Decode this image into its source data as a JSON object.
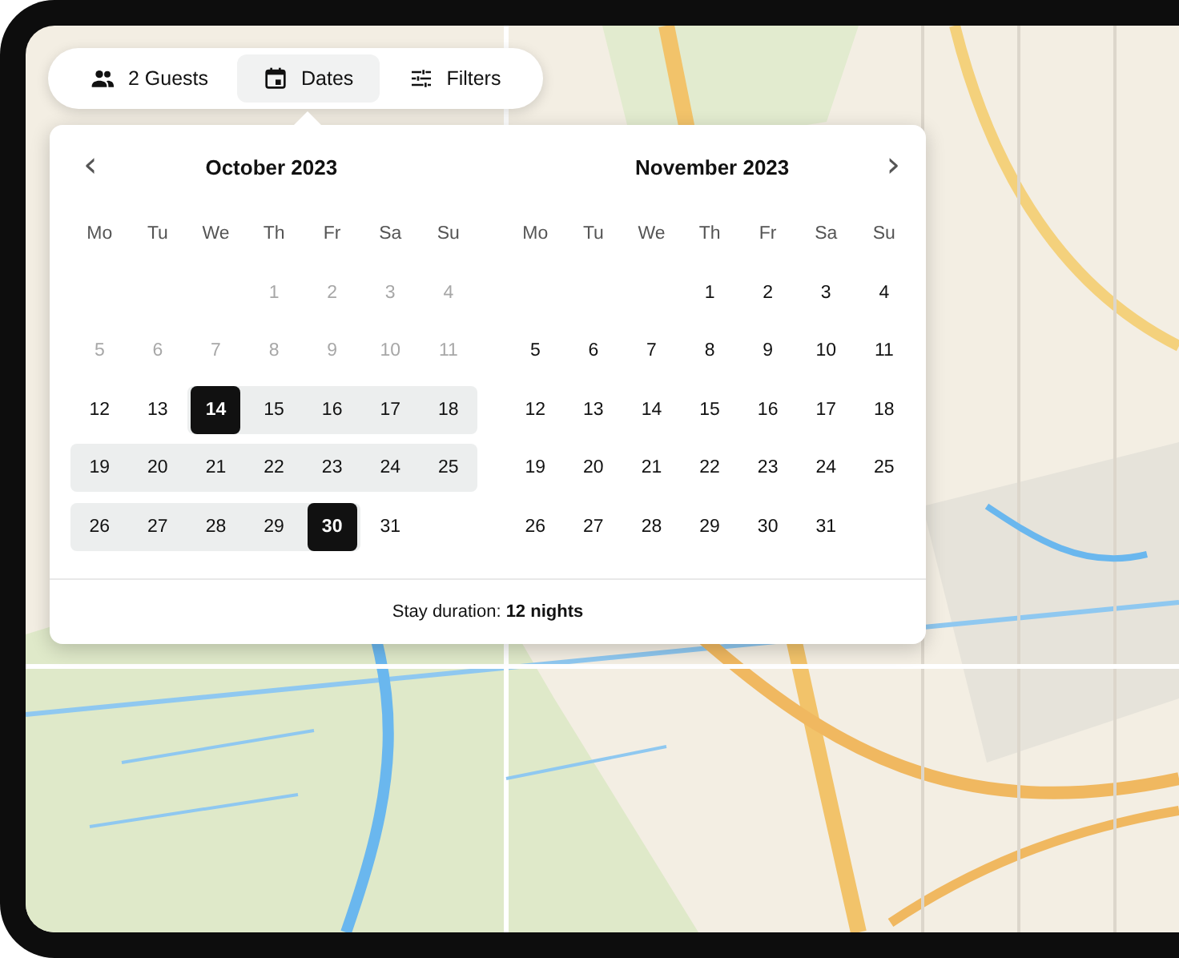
{
  "toolbar": {
    "items": [
      {
        "kind": "guests",
        "label": "2 Guests",
        "selected": false
      },
      {
        "kind": "dates",
        "label": "Dates",
        "selected": true
      },
      {
        "kind": "filters",
        "label": "Filters",
        "selected": false
      }
    ]
  },
  "calendar": {
    "prev_button": "‹",
    "next_button": "›",
    "months": [
      {
        "title": "October 2023",
        "weekdays": [
          "Mo",
          "Tu",
          "We",
          "Th",
          "Fr",
          "Sa",
          "Su"
        ],
        "weeks": [
          [
            {
              "kind": "blank"
            },
            {
              "kind": "blank"
            },
            {
              "kind": "blank"
            },
            {
              "kind": "date",
              "day": "1",
              "disabled": true,
              "selected": false,
              "in_range": false
            },
            {
              "kind": "date",
              "day": "2",
              "disabled": true,
              "selected": false,
              "in_range": false
            },
            {
              "kind": "date",
              "day": "3",
              "disabled": true,
              "selected": false,
              "in_range": false
            },
            {
              "kind": "date",
              "day": "4",
              "disabled": true,
              "selected": false,
              "in_range": false
            }
          ],
          [
            {
              "kind": "date",
              "day": "5",
              "disabled": true,
              "selected": false,
              "in_range": false
            },
            {
              "kind": "date",
              "day": "6",
              "disabled": true,
              "selected": false,
              "in_range": false
            },
            {
              "kind": "date",
              "day": "7",
              "disabled": true,
              "selected": false,
              "in_range": false
            },
            {
              "kind": "date",
              "day": "8",
              "disabled": true,
              "selected": false,
              "in_range": false
            },
            {
              "kind": "date",
              "day": "9",
              "disabled": true,
              "selected": false,
              "in_range": false
            },
            {
              "kind": "date",
              "day": "10",
              "disabled": true,
              "selected": false,
              "in_range": false
            },
            {
              "kind": "date",
              "day": "11",
              "disabled": true,
              "selected": false,
              "in_range": false
            }
          ],
          [
            {
              "kind": "date",
              "day": "12",
              "disabled": false,
              "selected": false,
              "in_range": false
            },
            {
              "kind": "date",
              "day": "13",
              "disabled": false,
              "selected": false,
              "in_range": false
            },
            {
              "kind": "date",
              "day": "14",
              "disabled": false,
              "selected": true,
              "in_range": true
            },
            {
              "kind": "date",
              "day": "15",
              "disabled": false,
              "selected": false,
              "in_range": true
            },
            {
              "kind": "date",
              "day": "16",
              "disabled": false,
              "selected": false,
              "in_range": true
            },
            {
              "kind": "date",
              "day": "17",
              "disabled": false,
              "selected": false,
              "in_range": true
            },
            {
              "kind": "date",
              "day": "18",
              "disabled": false,
              "selected": false,
              "in_range": true
            }
          ],
          [
            {
              "kind": "date",
              "day": "19",
              "disabled": false,
              "selected": false,
              "in_range": true
            },
            {
              "kind": "date",
              "day": "20",
              "disabled": false,
              "selected": false,
              "in_range": true
            },
            {
              "kind": "date",
              "day": "21",
              "disabled": false,
              "selected": false,
              "in_range": true
            },
            {
              "kind": "date",
              "day": "22",
              "disabled": false,
              "selected": false,
              "in_range": true
            },
            {
              "kind": "date",
              "day": "23",
              "disabled": false,
              "selected": false,
              "in_range": true
            },
            {
              "kind": "date",
              "day": "24",
              "disabled": false,
              "selected": false,
              "in_range": true
            },
            {
              "kind": "date",
              "day": "25",
              "disabled": false,
              "selected": false,
              "in_range": true
            }
          ],
          [
            {
              "kind": "date",
              "day": "26",
              "disabled": false,
              "selected": false,
              "in_range": true
            },
            {
              "kind": "date",
              "day": "27",
              "disabled": false,
              "selected": false,
              "in_range": true
            },
            {
              "kind": "date",
              "day": "28",
              "disabled": false,
              "selected": false,
              "in_range": true
            },
            {
              "kind": "date",
              "day": "29",
              "disabled": false,
              "selected": false,
              "in_range": true
            },
            {
              "kind": "date",
              "day": "30",
              "disabled": false,
              "selected": true,
              "in_range": true
            },
            {
              "kind": "date",
              "day": "31",
              "disabled": false,
              "selected": false,
              "in_range": false
            },
            {
              "kind": "blank"
            }
          ]
        ]
      },
      {
        "title": "November 2023",
        "weekdays": [
          "Mo",
          "Tu",
          "We",
          "Th",
          "Fr",
          "Sa",
          "Su"
        ],
        "weeks": [
          [
            {
              "kind": "blank"
            },
            {
              "kind": "blank"
            },
            {
              "kind": "blank"
            },
            {
              "kind": "date",
              "day": "1",
              "disabled": false,
              "selected": false,
              "in_range": false
            },
            {
              "kind": "date",
              "day": "2",
              "disabled": false,
              "selected": false,
              "in_range": false
            },
            {
              "kind": "date",
              "day": "3",
              "disabled": false,
              "selected": false,
              "in_range": false
            },
            {
              "kind": "date",
              "day": "4",
              "disabled": false,
              "selected": false,
              "in_range": false
            }
          ],
          [
            {
              "kind": "date",
              "day": "5",
              "disabled": false,
              "selected": false,
              "in_range": false
            },
            {
              "kind": "date",
              "day": "6",
              "disabled": false,
              "selected": false,
              "in_range": false
            },
            {
              "kind": "date",
              "day": "7",
              "disabled": false,
              "selected": false,
              "in_range": false
            },
            {
              "kind": "date",
              "day": "8",
              "disabled": false,
              "selected": false,
              "in_range": false
            },
            {
              "kind": "date",
              "day": "9",
              "disabled": false,
              "selected": false,
              "in_range": false
            },
            {
              "kind": "date",
              "day": "10",
              "disabled": false,
              "selected": false,
              "in_range": false
            },
            {
              "kind": "date",
              "day": "11",
              "disabled": false,
              "selected": false,
              "in_range": false
            }
          ],
          [
            {
              "kind": "date",
              "day": "12",
              "disabled": false,
              "selected": false,
              "in_range": false
            },
            {
              "kind": "date",
              "day": "13",
              "disabled": false,
              "selected": false,
              "in_range": false
            },
            {
              "kind": "date",
              "day": "14",
              "disabled": false,
              "selected": false,
              "in_range": false
            },
            {
              "kind": "date",
              "day": "15",
              "disabled": false,
              "selected": false,
              "in_range": false
            },
            {
              "kind": "date",
              "day": "16",
              "disabled": false,
              "selected": false,
              "in_range": false
            },
            {
              "kind": "date",
              "day": "17",
              "disabled": false,
              "selected": false,
              "in_range": false
            },
            {
              "kind": "date",
              "day": "18",
              "disabled": false,
              "selected": false,
              "in_range": false
            }
          ],
          [
            {
              "kind": "date",
              "day": "19",
              "disabled": false,
              "selected": false,
              "in_range": false
            },
            {
              "kind": "date",
              "day": "20",
              "disabled": false,
              "selected": false,
              "in_range": false
            },
            {
              "kind": "date",
              "day": "21",
              "disabled": false,
              "selected": false,
              "in_range": false
            },
            {
              "kind": "date",
              "day": "22",
              "disabled": false,
              "selected": false,
              "in_range": false
            },
            {
              "kind": "date",
              "day": "23",
              "disabled": false,
              "selected": false,
              "in_range": false
            },
            {
              "kind": "date",
              "day": "24",
              "disabled": false,
              "selected": false,
              "in_range": false
            },
            {
              "kind": "date",
              "day": "25",
              "disabled": false,
              "selected": false,
              "in_range": false
            }
          ],
          [
            {
              "kind": "date",
              "day": "26",
              "disabled": false,
              "selected": false,
              "in_range": false
            },
            {
              "kind": "date",
              "day": "27",
              "disabled": false,
              "selected": false,
              "in_range": false
            },
            {
              "kind": "date",
              "day": "28",
              "disabled": false,
              "selected": false,
              "in_range": false
            },
            {
              "kind": "date",
              "day": "29",
              "disabled": false,
              "selected": false,
              "in_range": false
            },
            {
              "kind": "date",
              "day": "30",
              "disabled": false,
              "selected": false,
              "in_range": false
            },
            {
              "kind": "date",
              "day": "31",
              "disabled": false,
              "selected": false,
              "in_range": false
            },
            {
              "kind": "blank"
            }
          ]
        ]
      }
    ],
    "footer": "Stay duration: **12 nights**"
  }
}
